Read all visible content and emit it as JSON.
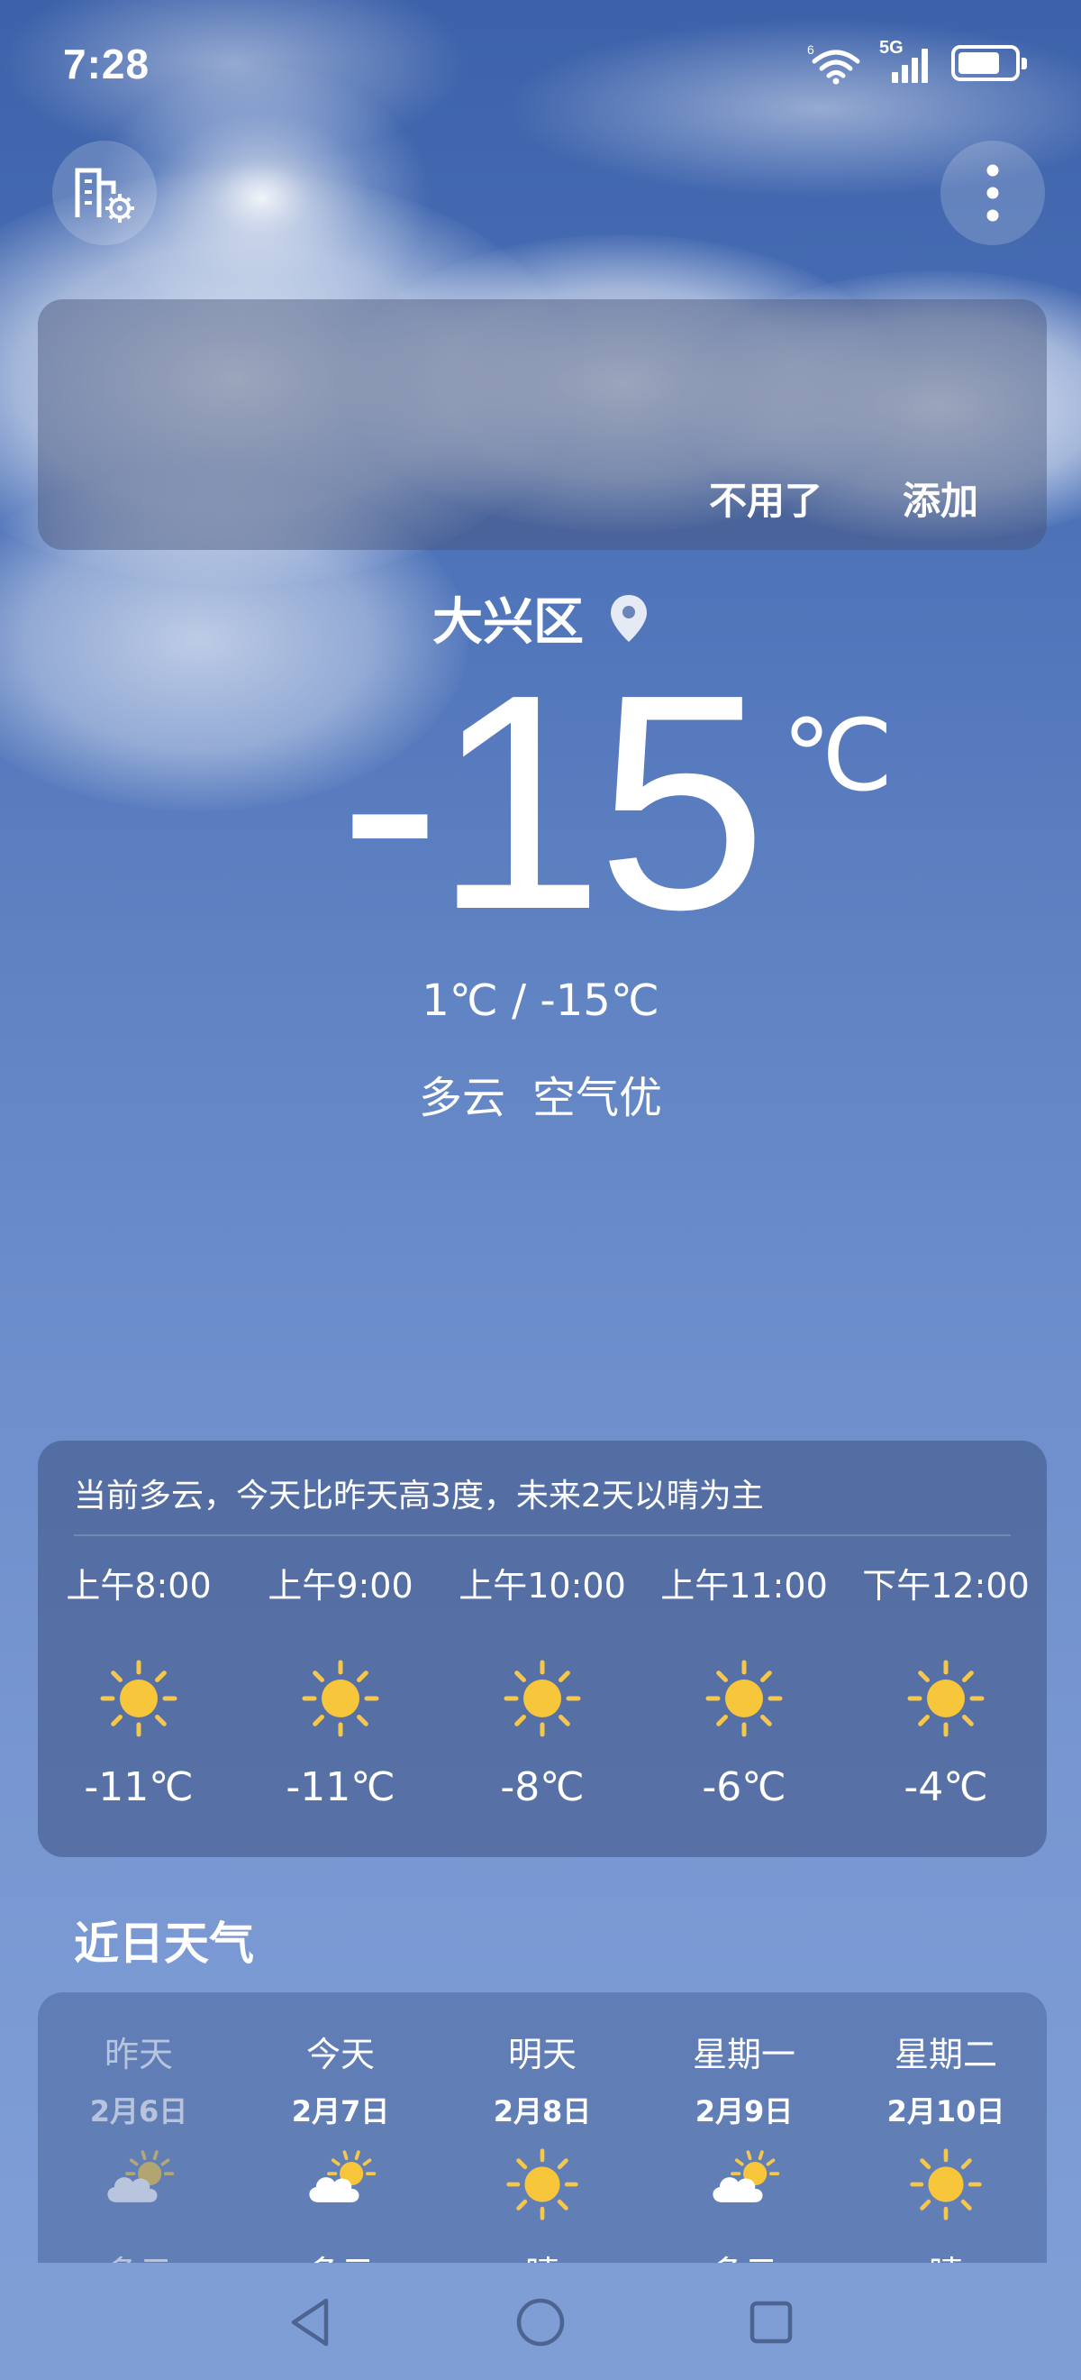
{
  "status_bar": {
    "time": "7:28",
    "wifi_badge": "6",
    "network": "5G",
    "battery_level": 0.75
  },
  "suggestion": {
    "dismiss_label": "不用了",
    "add_label": "添加"
  },
  "location": {
    "name": "大兴区"
  },
  "current": {
    "temperature": "-15",
    "unit": "℃",
    "range": "1℃ / -15℃",
    "condition": "多云",
    "air_quality": "空气优"
  },
  "hourly": {
    "summary": "当前多云，今天比昨天高3度，未来2天以晴为主",
    "items": [
      {
        "time": "上午8:00",
        "icon": "sun-icon",
        "temp": "-11℃"
      },
      {
        "time": "上午9:00",
        "icon": "sun-icon",
        "temp": "-11℃"
      },
      {
        "time": "上午10:00",
        "icon": "sun-icon",
        "temp": "-8℃"
      },
      {
        "time": "上午11:00",
        "icon": "sun-icon",
        "temp": "-6℃"
      },
      {
        "time": "下午12:00",
        "icon": "sun-icon",
        "temp": "-4℃"
      }
    ]
  },
  "recent": {
    "title": "近日天气",
    "days": [
      {
        "name": "昨天",
        "date": "2月6日",
        "icon": "partly-cloudy-icon",
        "condition": "多云"
      },
      {
        "name": "今天",
        "date": "2月7日",
        "icon": "partly-cloudy-icon",
        "condition": "多云"
      },
      {
        "name": "明天",
        "date": "2月8日",
        "icon": "sun-icon",
        "condition": "晴"
      },
      {
        "name": "星期一",
        "date": "2月9日",
        "icon": "partly-cloudy-icon",
        "condition": "多云"
      },
      {
        "name": "星期二",
        "date": "2月10日",
        "icon": "sun-icon",
        "condition": "晴"
      }
    ]
  },
  "colors": {
    "sun": "#f7c63a",
    "sun_ray": "#f5c84b",
    "cloud": "#ffffff"
  }
}
